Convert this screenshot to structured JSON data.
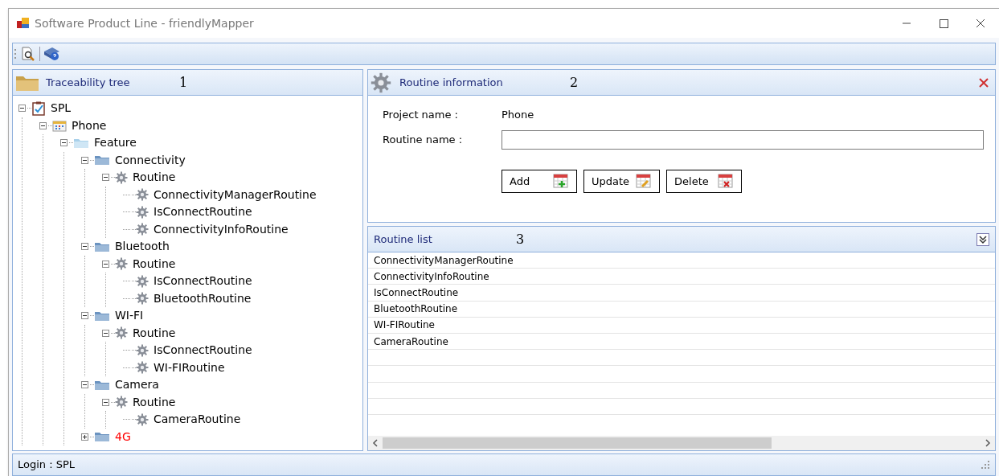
{
  "window": {
    "title": "Software Product Line - friendlyMapper"
  },
  "tree_panel": {
    "title": "Traceability tree",
    "marker": "1",
    "nodes": [
      {
        "label": "SPL",
        "kind": "project",
        "expanded": true,
        "color": "#000000",
        "children": [
          {
            "label": "Phone",
            "kind": "product",
            "expanded": true,
            "color": "#000000",
            "children": [
              {
                "label": "Feature",
                "kind": "folder",
                "expanded": true,
                "color": "#000000",
                "children": [
                  {
                    "label": "Connectivity",
                    "kind": "feature",
                    "expanded": true,
                    "color": "#000000",
                    "children": [
                      {
                        "label": "Routine",
                        "kind": "routines",
                        "expanded": true,
                        "color": "#000000",
                        "children": [
                          {
                            "label": "ConnectivityManagerRoutine",
                            "kind": "routine",
                            "color": "#000000"
                          },
                          {
                            "label": "IsConnectRoutine",
                            "kind": "routine",
                            "color": "#000000"
                          },
                          {
                            "label": "ConnectivityInfoRoutine",
                            "kind": "routine",
                            "color": "#000000"
                          }
                        ]
                      }
                    ]
                  },
                  {
                    "label": "Bluetooth",
                    "kind": "feature",
                    "expanded": true,
                    "color": "#000000",
                    "children": [
                      {
                        "label": "Routine",
                        "kind": "routines",
                        "expanded": true,
                        "color": "#000000",
                        "children": [
                          {
                            "label": "IsConnectRoutine",
                            "kind": "routine",
                            "color": "#000000"
                          },
                          {
                            "label": "BluetoothRoutine",
                            "kind": "routine",
                            "color": "#000000"
                          }
                        ]
                      }
                    ]
                  },
                  {
                    "label": "WI-FI",
                    "kind": "feature",
                    "expanded": true,
                    "color": "#000000",
                    "children": [
                      {
                        "label": "Routine",
                        "kind": "routines",
                        "expanded": true,
                        "color": "#000000",
                        "children": [
                          {
                            "label": "IsConnectRoutine",
                            "kind": "routine",
                            "color": "#000000"
                          },
                          {
                            "label": "WI-FIRoutine",
                            "kind": "routine",
                            "color": "#000000"
                          }
                        ]
                      }
                    ]
                  },
                  {
                    "label": "Camera",
                    "kind": "feature",
                    "expanded": true,
                    "color": "#000000",
                    "children": [
                      {
                        "label": "Routine",
                        "kind": "routines",
                        "expanded": true,
                        "color": "#000000",
                        "children": [
                          {
                            "label": "CameraRoutine",
                            "kind": "routine",
                            "color": "#000000"
                          }
                        ]
                      }
                    ]
                  },
                  {
                    "label": "4G",
                    "kind": "feature",
                    "expanded": false,
                    "color": "#ff0000"
                  }
                ]
              }
            ]
          }
        ]
      }
    ]
  },
  "info_panel": {
    "title": "Routine information",
    "marker": "2",
    "project_label": "Project name :",
    "project_value": "Phone",
    "routine_label": "Routine name :",
    "buttons": [
      {
        "label": "Add",
        "kind": "add"
      },
      {
        "label": "Update",
        "kind": "edit"
      },
      {
        "label": "Delete",
        "kind": "delete"
      }
    ]
  },
  "list_panel": {
    "title": "Routine list",
    "marker": "3",
    "items": [
      "ConnectivityManagerRoutine",
      "ConnectivityInfoRoutine",
      "IsConnectRoutine",
      "BluetoothRoutine",
      "WI-FIRoutine",
      "CameraRoutine"
    ]
  },
  "status_bar": {
    "text": "Login : SPL"
  }
}
